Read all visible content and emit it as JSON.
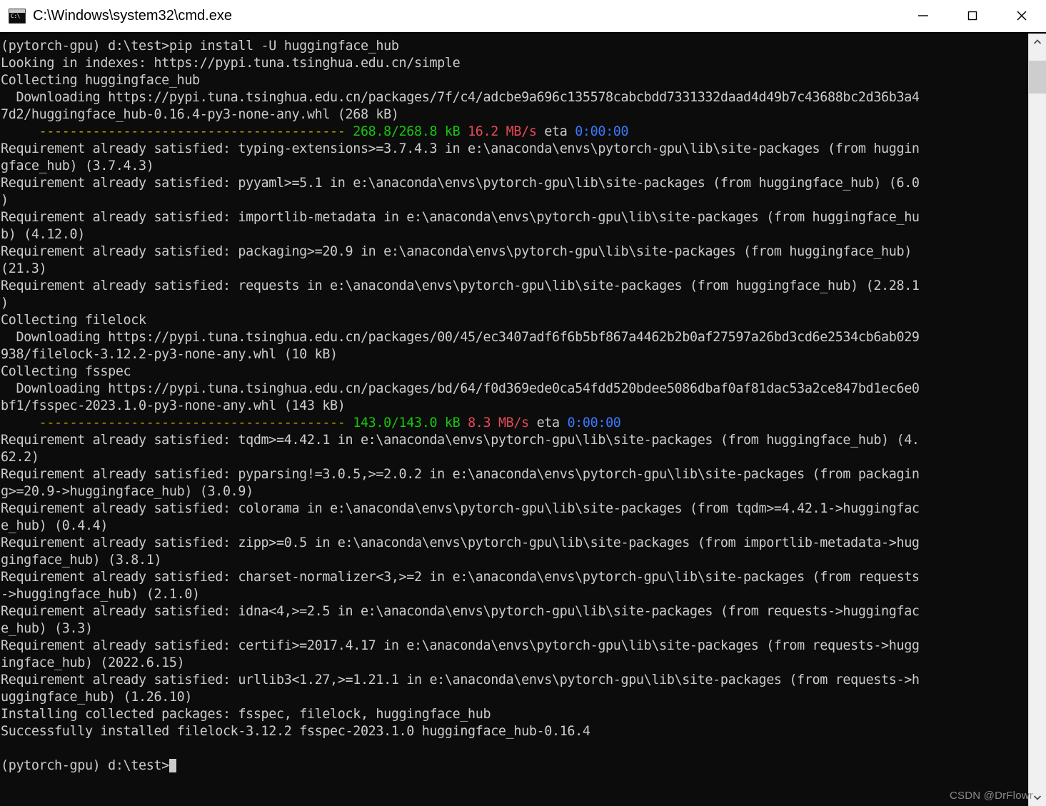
{
  "window": {
    "title": "C:\\Windows\\system32\\cmd.exe",
    "icon": "console-icon",
    "prompt_glyph": "C:\\",
    "controls": {
      "minimize": "Minimize",
      "maximize": "Maximize",
      "close": "Close"
    }
  },
  "scrollbar": {
    "up_arrow": "scroll-up-arrow",
    "down_arrow": "scroll-down-arrow"
  },
  "watermark": "CSDN @DrFlowr",
  "console": {
    "background_color": "#0c0c0c",
    "foreground_color": "#cccccc",
    "colors": {
      "green": "#16c60c",
      "red": "#e74856",
      "blue": "#3b78ff",
      "yellow": "#c19c00",
      "bright_white": "#f2f2f2"
    },
    "cwd": "d:\\test",
    "env": "(pytorch-gpu)",
    "command": "pip install -U huggingface_hub",
    "index_url": "https://pypi.tuna.tsinghua.edu.cn/simple",
    "lines": [
      "(pytorch-gpu) d:\\test>pip install -U huggingface_hub",
      "Looking in indexes: https://pypi.tuna.tsinghua.edu.cn/simple",
      "Collecting huggingface_hub",
      "  Downloading https://pypi.tuna.tsinghua.edu.cn/packages/7f/c4/adcbe9a696c135578cabcbdd7331332daad4d49b7c43688bc2d36b3a4",
      "7d2/huggingface_hub-0.16.4-py3-none-any.whl (268 kB)",
      "     ---------------------------------------- 268.8/268.8 kB 16.2 MB/s eta 0:00:00",
      "Requirement already satisfied: typing-extensions>=3.7.4.3 in e:\\anaconda\\envs\\pytorch-gpu\\lib\\site-packages (from huggin",
      "gface_hub) (3.7.4.3)",
      "Requirement already satisfied: pyyaml>=5.1 in e:\\anaconda\\envs\\pytorch-gpu\\lib\\site-packages (from huggingface_hub) (6.0",
      ")",
      "Requirement already satisfied: importlib-metadata in e:\\anaconda\\envs\\pytorch-gpu\\lib\\site-packages (from huggingface_hu",
      "b) (4.12.0)",
      "Requirement already satisfied: packaging>=20.9 in e:\\anaconda\\envs\\pytorch-gpu\\lib\\site-packages (from huggingface_hub)",
      "(21.3)",
      "Requirement already satisfied: requests in e:\\anaconda\\envs\\pytorch-gpu\\lib\\site-packages (from huggingface_hub) (2.28.1",
      ")",
      "Collecting filelock",
      "  Downloading https://pypi.tuna.tsinghua.edu.cn/packages/00/45/ec3407adf6f6b5bf867a4462b2b0af27597a26bd3cd6e2534cb6ab029",
      "938/filelock-3.12.2-py3-none-any.whl (10 kB)",
      "Collecting fsspec",
      "  Downloading https://pypi.tuna.tsinghua.edu.cn/packages/bd/64/f0d369ede0ca54fdd520bdee5086dbaf0af81dac53a2ce847bd1ec6e0",
      "bf1/fsspec-2023.1.0-py3-none-any.whl (143 kB)",
      "     ---------------------------------------- 143.0/143.0 kB 8.3 MB/s eta 0:00:00",
      "Requirement already satisfied: tqdm>=4.42.1 in e:\\anaconda\\envs\\pytorch-gpu\\lib\\site-packages (from huggingface_hub) (4.",
      "62.2)",
      "Requirement already satisfied: pyparsing!=3.0.5,>=2.0.2 in e:\\anaconda\\envs\\pytorch-gpu\\lib\\site-packages (from packagin",
      "g>=20.9->huggingface_hub) (3.0.9)",
      "Requirement already satisfied: colorama in e:\\anaconda\\envs\\pytorch-gpu\\lib\\site-packages (from tqdm>=4.42.1->huggingfac",
      "e_hub) (0.4.4)",
      "Requirement already satisfied: zipp>=0.5 in e:\\anaconda\\envs\\pytorch-gpu\\lib\\site-packages (from importlib-metadata->hug",
      "gingface_hub) (3.8.1)",
      "Requirement already satisfied: charset-normalizer<3,>=2 in e:\\anaconda\\envs\\pytorch-gpu\\lib\\site-packages (from requests",
      "->huggingface_hub) (2.1.0)",
      "Requirement already satisfied: idna<4,>=2.5 in e:\\anaconda\\envs\\pytorch-gpu\\lib\\site-packages (from requests->huggingfac",
      "e_hub) (3.3)",
      "Requirement already satisfied: certifi>=2017.4.17 in e:\\anaconda\\envs\\pytorch-gpu\\lib\\site-packages (from requests->hugg",
      "ingface_hub) (2022.6.15)",
      "Requirement already satisfied: urllib3<1.27,>=1.21.1 in e:\\anaconda\\envs\\pytorch-gpu\\lib\\site-packages (from requests->h",
      "uggingface_hub) (1.26.10)",
      "Installing collected packages: fsspec, filelock, huggingface_hub",
      "Successfully installed filelock-3.12.2 fsspec-2023.1.0 huggingface_hub-0.16.4",
      "",
      "(pytorch-gpu) d:\\test>"
    ],
    "progress_lines": [
      {
        "index": 5,
        "bar": "     ----------------------------------------",
        "size": " 268.8/268.8 kB",
        "speed": " 16.2 MB/s",
        "eta_label": " eta",
        "eta": " 0:00:00"
      },
      {
        "index": 22,
        "bar": "     ----------------------------------------",
        "size": " 143.0/143.0 kB",
        "speed": " 8.3 MB/s",
        "eta_label": " eta",
        "eta": " 0:00:00"
      }
    ],
    "final_prompt": "(pytorch-gpu) d:\\test>"
  }
}
